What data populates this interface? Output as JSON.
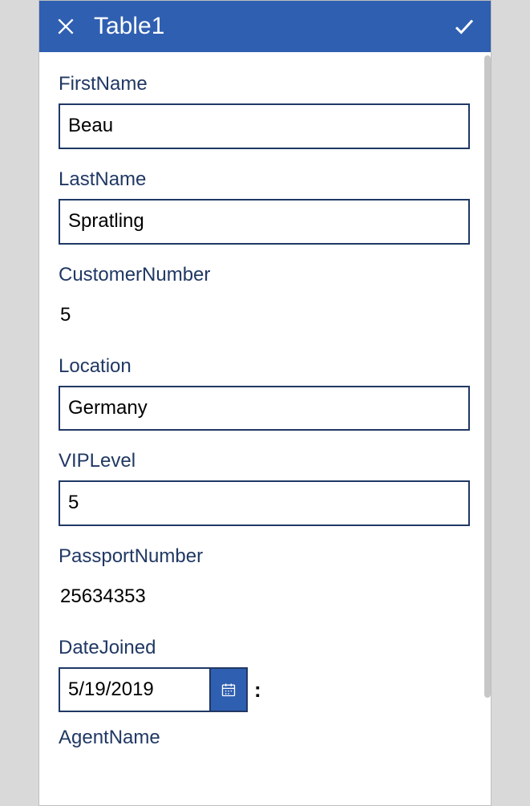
{
  "header": {
    "title": "Table1"
  },
  "form": {
    "firstName": {
      "label": "FirstName",
      "value": "Beau"
    },
    "lastName": {
      "label": "LastName",
      "value": "Spratling"
    },
    "customerNumber": {
      "label": "CustomerNumber",
      "value": "5"
    },
    "location": {
      "label": "Location",
      "value": "Germany"
    },
    "vipLevel": {
      "label": "VIPLevel",
      "value": "5"
    },
    "passportNumber": {
      "label": "PassportNumber",
      "value": "25634353"
    },
    "dateJoined": {
      "label": "DateJoined",
      "value": "5/19/2019"
    },
    "agentName": {
      "label": "AgentName"
    }
  }
}
